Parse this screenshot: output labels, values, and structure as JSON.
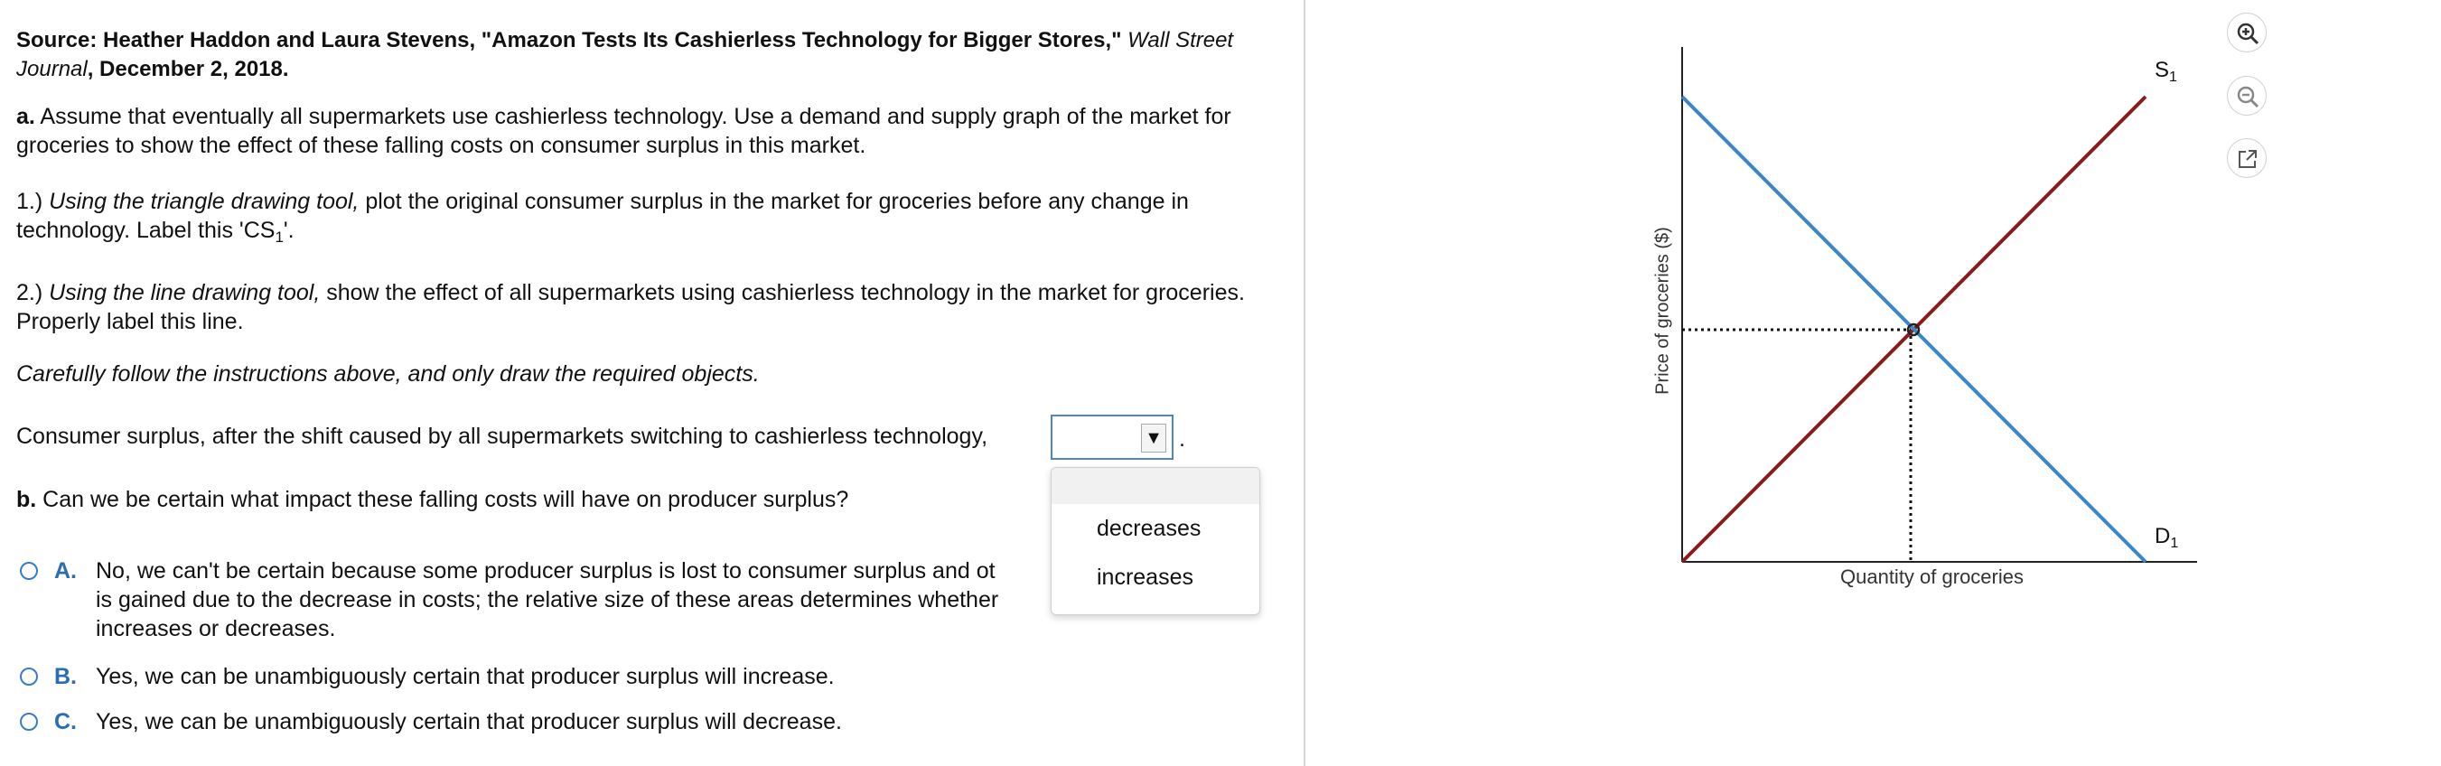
{
  "source": {
    "prefix": "Source: Heather Haddon and Laura Stevens, \"Amazon Tests Its Cashierless Technology for Bigger Stores,\" ",
    "journal": "Wall Street Journal",
    "date": ", December 2, 2018."
  },
  "part_a": {
    "letter": "a.",
    "text": " Assume that eventually all supermarkets use cashierless technology. Use a demand and supply graph of the market for groceries to show the effect of these falling costs on consumer surplus in this market."
  },
  "step1": {
    "num": "1.) ",
    "tool": "Using the triangle drawing tool,",
    "text": " plot the original consumer surplus in the market for groceries before any change in technology. Label this 'CS",
    "sub": "1",
    "end": "'."
  },
  "step2": {
    "num": "2.) ",
    "tool": "Using the line drawing tool,",
    "text": " show the effect of all supermarkets using cashierless technology in the market for groceries. Properly label this line."
  },
  "careful_text": "Carefully follow the instructions above, and only draw the required objects.",
  "cs_sentence": "Consumer surplus, after the shift caused by all supermarkets switching to cashierless technology,",
  "select": {
    "value": "",
    "arrow": "▼",
    "after": ".",
    "options": [
      "decreases",
      "increases"
    ]
  },
  "part_b": {
    "letter": "b.",
    "text": " Can we be certain what impact these falling costs will have on producer surplus?"
  },
  "options": [
    {
      "letter": "A.",
      "text": "No, we can't be certain because some producer surplus is lost to consumer surplus and ot"
    },
    {
      "letter": "",
      "text": "is gained due to the decrease in costs; the relative size of these areas determines whether"
    },
    {
      "letter": "",
      "text": "increases or decreases."
    },
    {
      "letter": "B.",
      "text": "Yes, we can be unambiguously certain that producer surplus will increase."
    },
    {
      "letter": "C.",
      "text": "Yes, we can be unambiguously certain that producer surplus will decrease."
    }
  ],
  "graph": {
    "y_axis_label": "Price of groceries ($)",
    "x_axis_label": "Quantity of groceries",
    "supply_label": "S",
    "supply_sub": "1",
    "demand_label": "D",
    "demand_sub": "1",
    "supply_color": "#8b1a1a",
    "demand_color": "#3a86c8"
  },
  "toolbar": {
    "zoom_in_icon": "zoom-in-icon",
    "zoom_out_icon": "zoom-out-icon",
    "popout_icon": "popout-icon"
  }
}
